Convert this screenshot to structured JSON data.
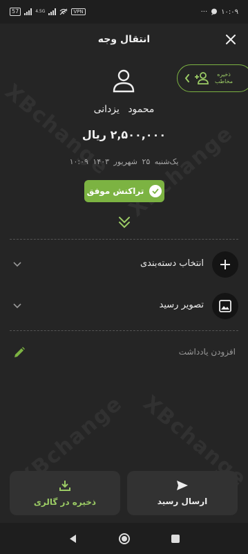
{
  "status_bar": {
    "battery": "57",
    "network_type": "4.5G",
    "vpn": "VPN",
    "time": "۱۰:۰۹",
    "dots": "···"
  },
  "header": {
    "title": "انتقال وجه"
  },
  "save_contact": {
    "label": "ذخیره\nمخاطب"
  },
  "receipt": {
    "name": "محمود  یزدانی",
    "amount": "۲,۵۰۰,۰۰۰ ریال",
    "date": "یک‌شنبه ۲۵ شهریور ۱۴۰۳  ۱۰:۰۹",
    "status": "تراکنش موفق"
  },
  "options": {
    "category_label": "انتخاب دسته‌بندی",
    "receipt_image_label": "تصویر رسید",
    "add_note_label": "افزودن یادداشت"
  },
  "actions": {
    "save_gallery": "ذخیره در گالری",
    "send_receipt": "ارسال رسید"
  },
  "watermark": "XBchange",
  "colors": {
    "accent": "#7cb342",
    "background": "#252525"
  }
}
